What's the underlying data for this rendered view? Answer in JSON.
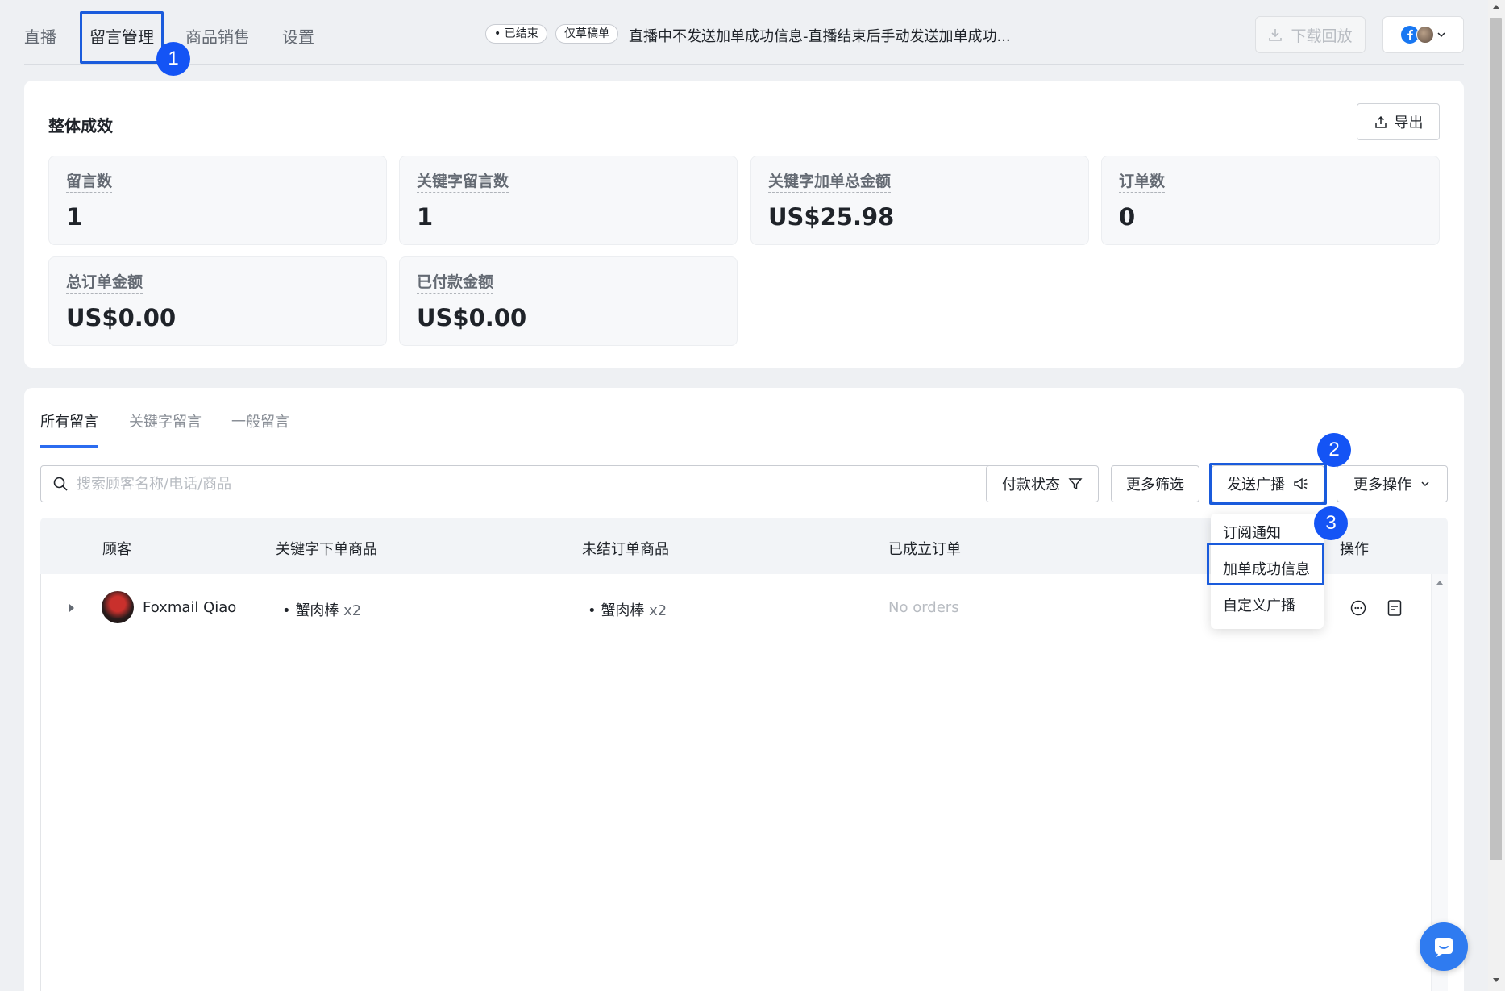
{
  "topnav": {
    "tabs": [
      {
        "label": "直播"
      },
      {
        "label": "留言管理"
      },
      {
        "label": "商品销售"
      },
      {
        "label": "设置"
      }
    ],
    "status_pill": "• 已结束",
    "draft_pill": "仅草稿单",
    "live_title": "直播中不发送加单成功信息-直播结束后手动发送加单成功...",
    "download_label": "下载回放"
  },
  "steps": [
    "1",
    "2",
    "3"
  ],
  "summary": {
    "title": "整体成效",
    "export_label": "导出",
    "stats": [
      {
        "label": "留言数",
        "value": "1"
      },
      {
        "label": "关键字留言数",
        "value": "1"
      },
      {
        "label": "关键字加单总金额",
        "value": "US$25.98"
      },
      {
        "label": "订单数",
        "value": "0"
      },
      {
        "label": "总订单金额",
        "value": "US$0.00"
      },
      {
        "label": "已付款金额",
        "value": "US$0.00"
      }
    ]
  },
  "comments": {
    "tabs": [
      {
        "label": "所有留言"
      },
      {
        "label": "关键字留言"
      },
      {
        "label": "一般留言"
      }
    ],
    "search_placeholder": "搜索顾客名称/电话/商品",
    "filters": {
      "payment_status": "付款状态",
      "more_filters": "更多筛选",
      "broadcast": "发送广播",
      "more_actions": "更多操作"
    },
    "columns": [
      "顾客",
      "关键字下单商品",
      "未结订单商品",
      "已成立订单",
      "操作"
    ],
    "rows": [
      {
        "customer": "Foxmail Qiao",
        "keyword_item": "蟹肉棒",
        "keyword_qty": "x2",
        "open_item": "蟹肉棒",
        "open_qty": "x2",
        "orders": "No orders"
      }
    ],
    "broadcast_menu": [
      "订阅通知",
      "加单成功信息",
      "自定义广播"
    ]
  },
  "colors": {
    "accent": "#2b6cf0",
    "highlight": "#1a5bdc",
    "step_badge": "#1454f5"
  }
}
